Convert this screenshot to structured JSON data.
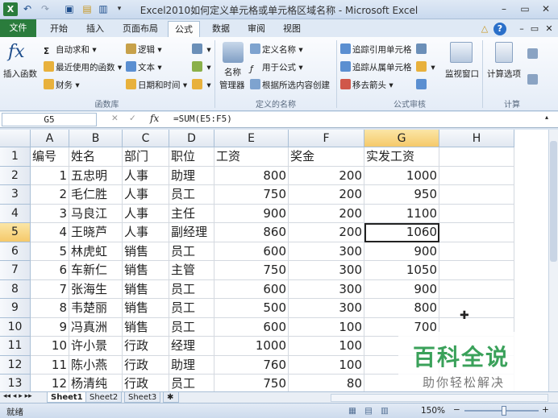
{
  "window": {
    "title": "Excel2010如何定义单元格或单元格区域名称 - Microsoft Excel",
    "minimize": "–",
    "maximize": "▭",
    "close": "✕"
  },
  "tabs": [
    "文件",
    "开始",
    "插入",
    "页面布局",
    "公式",
    "数据",
    "审阅",
    "视图"
  ],
  "ribbon": {
    "insert_function": "插入函数",
    "fx": "fx",
    "autosum": "自动求和",
    "recent": "最近使用的函数",
    "finance": "财务",
    "logic": "逻辑",
    "text": "文本",
    "datetime": "日期和时间",
    "group_library": "函数库",
    "name_manager_1": "名称",
    "name_manager_2": "管理器",
    "define_name": "定义名称",
    "use_in_formula": "用于公式",
    "create_from_sel": "根据所选内容创建",
    "group_names": "定义的名称",
    "trace_precedents": "追踪引用单元格",
    "trace_dependents": "追踪从属单元格",
    "remove_arrows": "移去箭头",
    "group_audit": "公式审核",
    "watch_window": "监视窗口",
    "calc_options": "计算选项",
    "group_calc": "计算"
  },
  "formula_bar": {
    "name_box": "G5",
    "fx": "fx",
    "formula": "=SUM(E5:F5)"
  },
  "sheet": {
    "columns": [
      "A",
      "B",
      "C",
      "D",
      "E",
      "F",
      "G",
      "H"
    ],
    "row_numbers": [
      "1",
      "2",
      "3",
      "4",
      "5",
      "6",
      "7",
      "8",
      "9",
      "10",
      "11",
      "12",
      "13"
    ],
    "rows": [
      [
        "编号",
        "姓名",
        "部门",
        "职位",
        "工资",
        "奖金",
        "实发工资",
        ""
      ],
      [
        "1",
        "五忠明",
        "人事",
        "助理",
        "800",
        "200",
        "1000",
        ""
      ],
      [
        "2",
        "毛仁胜",
        "人事",
        "员工",
        "750",
        "200",
        "950",
        ""
      ],
      [
        "3",
        "马良江",
        "人事",
        "主任",
        "900",
        "200",
        "1100",
        ""
      ],
      [
        "4",
        "王晓芦",
        "人事",
        "副经理",
        "860",
        "200",
        "1060",
        ""
      ],
      [
        "5",
        "林虎虹",
        "销售",
        "员工",
        "600",
        "300",
        "900",
        ""
      ],
      [
        "6",
        "车新仁",
        "销售",
        "主管",
        "750",
        "300",
        "1050",
        ""
      ],
      [
        "7",
        "张海生",
        "销售",
        "员工",
        "600",
        "300",
        "900",
        ""
      ],
      [
        "8",
        "韦楚丽",
        "销售",
        "员工",
        "500",
        "300",
        "800",
        ""
      ],
      [
        "9",
        "冯真洲",
        "销售",
        "员工",
        "600",
        "100",
        "700",
        ""
      ],
      [
        "10",
        "许小景",
        "行政",
        "经理",
        "1000",
        "100",
        "",
        ""
      ],
      [
        "11",
        "陈小燕",
        "行政",
        "助理",
        "760",
        "100",
        "",
        ""
      ],
      [
        "12",
        "杨清纯",
        "行政",
        "员工",
        "750",
        "80",
        "",
        ""
      ]
    ]
  },
  "sheet_tabs": [
    "Sheet1",
    "Sheet2",
    "Sheet3"
  ],
  "status": {
    "ready": "就绪",
    "zoom": "150%",
    "minus": "−",
    "plus": "+"
  },
  "watermark": {
    "main": "百科全说",
    "sub": "助你轻松解决"
  },
  "colors": {
    "file_tab": "#2a7c3c",
    "selection_header": "#f5c96a",
    "watermark_green": "#3aa15a"
  }
}
